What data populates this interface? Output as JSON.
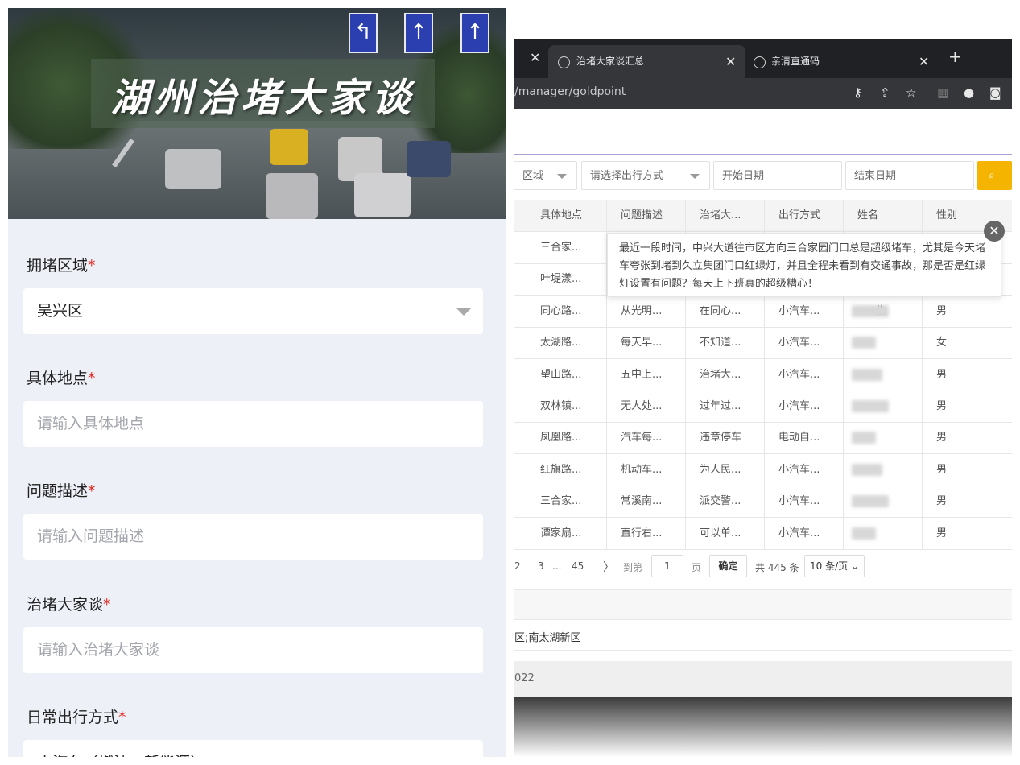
{
  "left": {
    "banner_title": "湖州治堵大家谈",
    "fields": [
      {
        "label": "拥堵区域",
        "required": "*",
        "value": "吴兴区",
        "type": "select"
      },
      {
        "label": "具体地点",
        "required": "*",
        "placeholder": "请输入具体地点"
      },
      {
        "label": "问题描述",
        "required": "*",
        "placeholder": "请输入问题描述"
      },
      {
        "label": "治堵大家谈",
        "required": "*",
        "placeholder": "请输入治堵大家谈"
      },
      {
        "label": "日常出行方式",
        "required": "*",
        "value": "小汽车（燃油、新能源）"
      }
    ]
  },
  "browser": {
    "tabs": [
      {
        "label": "治堵大家谈汇总",
        "icon": "globe-icon"
      },
      {
        "label": "亲清直通码",
        "icon": "globe-icon"
      }
    ],
    "new_tab": "+",
    "url": "/manager/goldpoint",
    "filters": {
      "area": "区域",
      "travel_mode": "请选择出行方式",
      "start_date": "开始日期",
      "end_date": "结束日期",
      "search_icon": "search-icon"
    },
    "table": {
      "headers": [
        "具体地点",
        "问题描述",
        "治堵大...",
        "出行方式",
        "姓名",
        "性别"
      ],
      "rows": [
        {
          "place": "三合家...",
          "desc": "",
          "talk": "",
          "mode": "",
          "name": "",
          "gender": ""
        },
        {
          "place": "叶堤漾...",
          "desc": "",
          "talk": "",
          "mode": "",
          "name": "",
          "gender": ""
        },
        {
          "place": "同心路...",
          "desc": "从光明...",
          "talk": "在同心...",
          "mode": "小汽车...",
          "name": "生",
          "gender": "男"
        },
        {
          "place": "太湖路...",
          "desc": "每天早...",
          "talk": "不知道...",
          "mode": "小汽车...",
          "name": "",
          "gender": "女"
        },
        {
          "place": "望山路...",
          "desc": "五中上...",
          "talk": "治堵大...",
          "mode": "小汽车...",
          "name": "",
          "gender": "男"
        },
        {
          "place": "双林镇...",
          "desc": "无人处...",
          "talk": "过年过...",
          "mode": "小汽车...",
          "name": "",
          "gender": "男"
        },
        {
          "place": "凤凰路...",
          "desc": "汽车每...",
          "talk": "违章停车",
          "mode": "电动自...",
          "name": "",
          "gender": "男"
        },
        {
          "place": "红旗路...",
          "desc": "机动车...",
          "talk": "为人民...",
          "mode": "小汽车...",
          "name": "",
          "gender": "男"
        },
        {
          "place": "三合家...",
          "desc": "常溪南...",
          "talk": "派交警...",
          "mode": "小汽车...",
          "name": "",
          "gender": "男"
        },
        {
          "place": "谭家扇...",
          "desc": "直行右...",
          "talk": "可以单...",
          "mode": "小汽车...",
          "name": "",
          "gender": "男"
        }
      ]
    },
    "tooltip": "最近一段时间，中兴大道往市区方向三合家园门口总是超级堵车，尤其是今天堵车夸张到堵到久立集团门口红绿灯，并且全程未看到有交通事故，那是否是红绿灯设置有问题？每天上下班真的超级糟心！",
    "pager": {
      "pages": [
        "2",
        "3",
        "...",
        "45"
      ],
      "next": "〉",
      "goto": "到第",
      "page_input": "1",
      "page_unit": "页",
      "confirm": "确定",
      "total": "共 445 条",
      "per_page": "10 条/页"
    },
    "region_text": "区;南太湖新区",
    "footer_text": "022"
  }
}
